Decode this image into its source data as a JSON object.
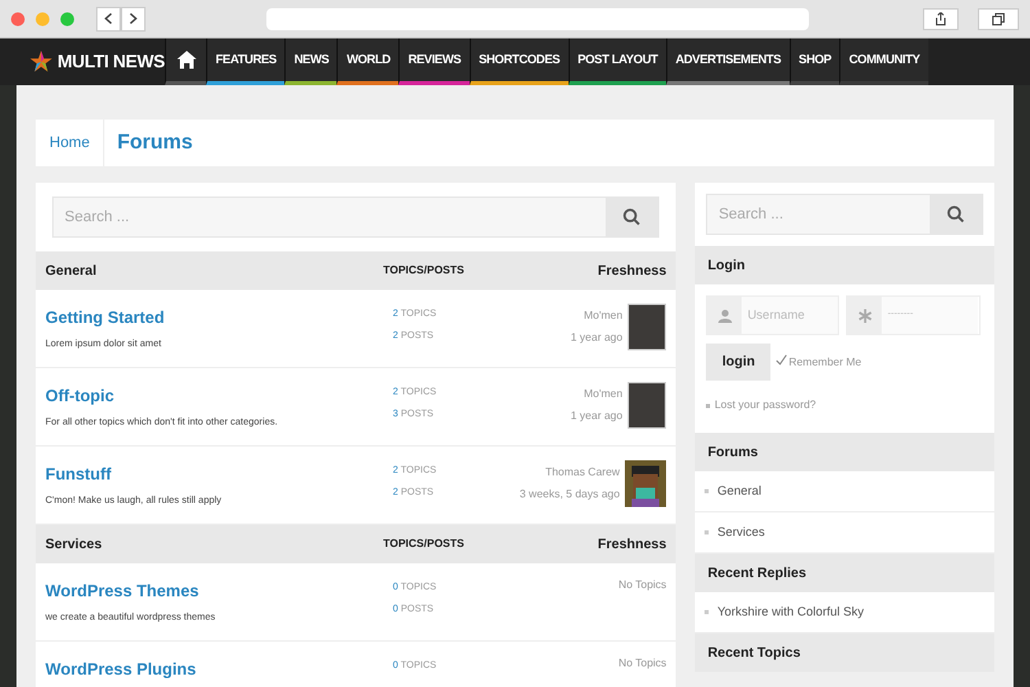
{
  "site": {
    "logo": "MULTI NEWS"
  },
  "nav": [
    {
      "label": "FEATURES",
      "color": "#2f9fd8"
    },
    {
      "label": "NEWS",
      "color": "#8db530"
    },
    {
      "label": "WORLD",
      "color": "#e0701e"
    },
    {
      "label": "REVIEWS",
      "color": "#d6249a"
    },
    {
      "label": "SHORTCODES",
      "color": "#e8a21a"
    },
    {
      "label": "POST LAYOUT",
      "color": "#1fa050"
    },
    {
      "label": "ADVERTISEMENTS",
      "color": "#777777"
    },
    {
      "label": "SHOP",
      "color": "#444444"
    },
    {
      "label": "COMMUNITY",
      "color": "#3a3a3a"
    }
  ],
  "breadcrumb": {
    "home": "Home",
    "title": "Forums"
  },
  "search": {
    "placeholder": "Search ..."
  },
  "groups": [
    {
      "name": "General",
      "counts_header": "TOPICS/POSTS",
      "freshness_header": "Freshness",
      "forums": [
        {
          "title": "Getting Started",
          "description": "Lorem ipsum dolor sit amet",
          "topics": "2",
          "topics_label": "TOPICS",
          "posts": "2",
          "posts_label": "POSTS",
          "author": "Mo'men",
          "time": "1 year ago",
          "avatar": {
            "kind": "photo"
          }
        },
        {
          "title": "Off-topic",
          "description": "For all other topics which don't fit into other categories.",
          "topics": "2",
          "topics_label": "TOPICS",
          "posts": "3",
          "posts_label": "POSTS",
          "author": "Mo'men",
          "time": "1 year ago",
          "avatar": {
            "kind": "photo"
          }
        },
        {
          "title": "Funstuff",
          "description": "C'mon! Make us laugh, all rules still apply",
          "topics": "2",
          "topics_label": "TOPICS",
          "posts": "2",
          "posts_label": "POSTS",
          "author": "Thomas Carew",
          "time": "3 weeks, 5 days ago",
          "avatar": {
            "kind": "cartoon"
          }
        }
      ]
    },
    {
      "name": "Services",
      "counts_header": "TOPICS/POSTS",
      "freshness_header": "Freshness",
      "forums": [
        {
          "title": "WordPress Themes",
          "description": "we create a beautiful wordpress themes",
          "topics": "0",
          "topics_label": "TOPICS",
          "posts": "0",
          "posts_label": "POSTS",
          "empty": "No Topics"
        },
        {
          "title": "WordPress Plugins",
          "topics": "0",
          "topics_label": "TOPICS",
          "empty": "No Topics"
        }
      ]
    }
  ],
  "sidebar": {
    "search": {
      "placeholder": "Search ..."
    },
    "login": {
      "title": "Login",
      "username_placeholder": "Username",
      "password_value": "--------",
      "button": "login",
      "remember": {
        "label": "Remember Me",
        "checked": true
      },
      "lost": "Lost your password?"
    },
    "sections": [
      {
        "title": "Forums",
        "items": [
          "General",
          "Services"
        ]
      },
      {
        "title": "Recent Replies",
        "items": [
          "Yorkshire with Colorful Sky"
        ]
      },
      {
        "title": "Recent Topics"
      }
    ]
  }
}
